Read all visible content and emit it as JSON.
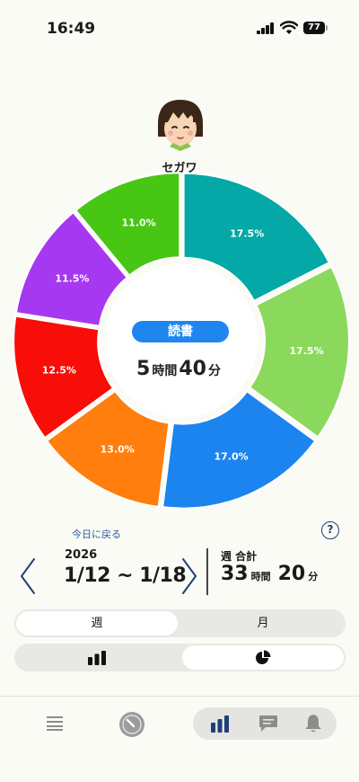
{
  "status": {
    "time": "16:49",
    "battery": "77"
  },
  "user": {
    "name": "セガワ"
  },
  "center": {
    "category": "読書",
    "hours": "5",
    "hours_unit": "時間",
    "minutes": "40",
    "minutes_unit": "分"
  },
  "chart_data": {
    "type": "pie",
    "donut": true,
    "slices": [
      {
        "label": "17.5%",
        "value": 17.5,
        "color": "#04a8a6"
      },
      {
        "label": "17.5%",
        "value": 17.5,
        "color": "#8bd95c"
      },
      {
        "label": "17.0%",
        "value": 17.0,
        "color": "#1c84ef"
      },
      {
        "label": "13.0%",
        "value": 13.0,
        "color": "#ff7e0d"
      },
      {
        "label": "12.5%",
        "value": 12.5,
        "color": "#f80d08"
      },
      {
        "label": "11.5%",
        "value": 11.5,
        "color": "#a638f1"
      },
      {
        "label": "11.0%",
        "value": 11.0,
        "color": "#48c614"
      }
    ]
  },
  "week": {
    "back_to_today": "今日に戻る",
    "year": "2026",
    "range": "1/12 ~ 1/18",
    "total_label": "週 合計",
    "hours": "33",
    "hours_unit": "時間",
    "minutes": "20",
    "minutes_unit": "分"
  },
  "period_toggle": {
    "week": "週",
    "month": "月",
    "selected": "week"
  },
  "chart_toggle": {
    "selected": "pie"
  },
  "nav": {
    "items": [
      "menu-icon",
      "gauge-icon",
      "bar-chart-icon",
      "chat-icon",
      "bell-icon"
    ]
  },
  "colors": {
    "accent": "#1f86f0",
    "nav_active": "#213f77"
  }
}
